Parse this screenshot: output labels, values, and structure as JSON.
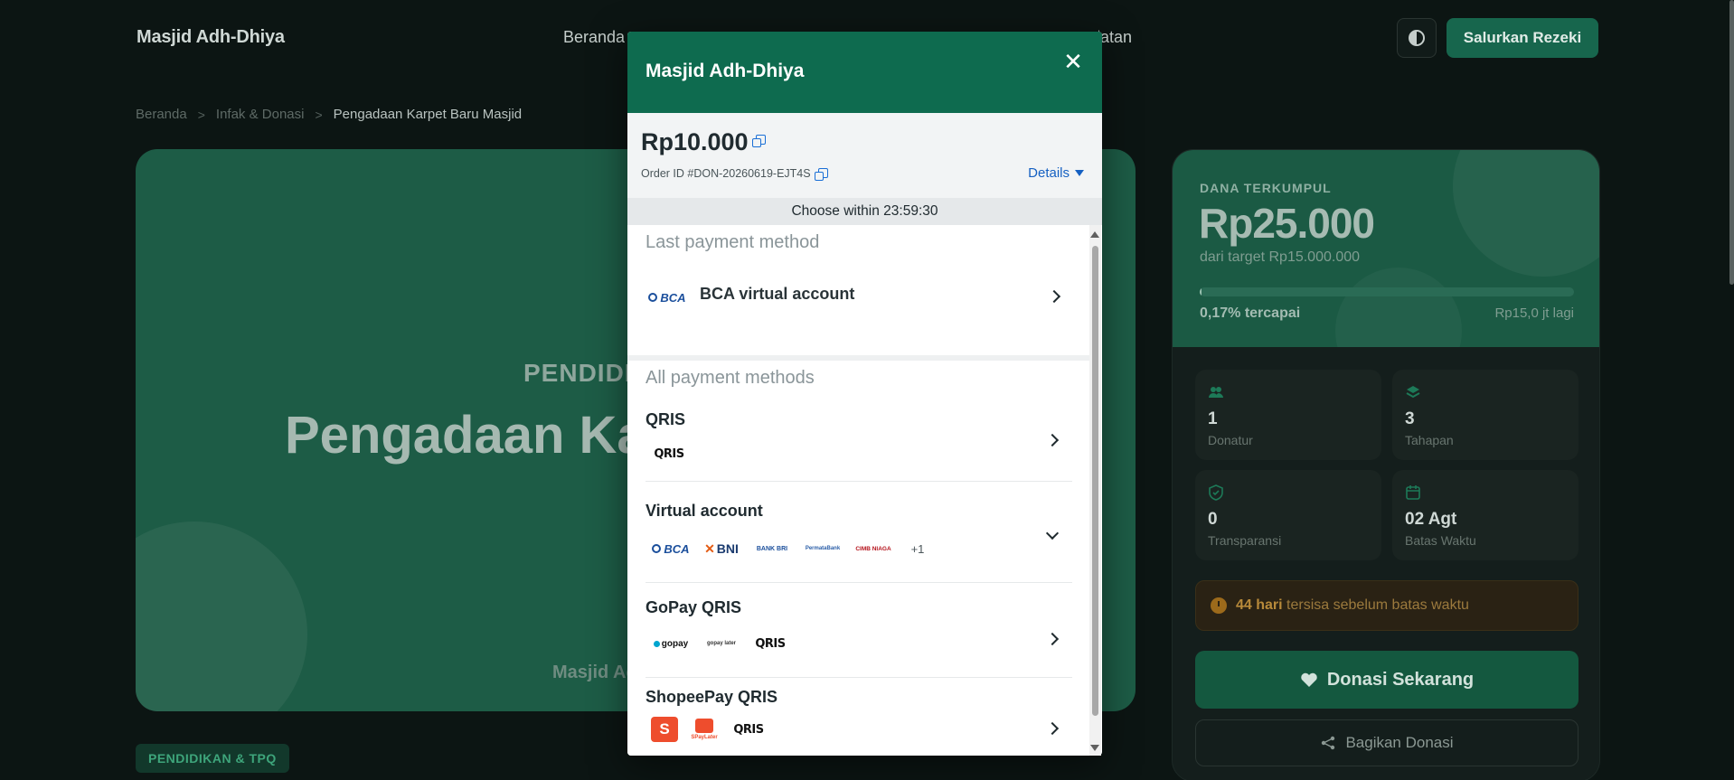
{
  "header": {
    "brand": "Masjid Adh-Dhiya",
    "nav": [
      "Beranda",
      "Kegiatan"
    ],
    "cta": "Salurkan Rezeki",
    "theme_icon": "half-circle-icon"
  },
  "breadcrumb": [
    "Beranda",
    "Infak & Donasi",
    "Pengadaan Karpet Baru Masjid"
  ],
  "hero": {
    "category": "PENDIDIKAN",
    "title": "Pengadaan Karpet Baru Masjid",
    "subtitle": "Masjid Adh-Dhiya",
    "badge": "PENDIDIKAN & TPQ"
  },
  "fund": {
    "label": "DANA TERKUMPUL",
    "value": "Rp25.000",
    "target": "dari target Rp15.000.000",
    "progress_percent": 0.17,
    "progress_text": "0,17% tercapai",
    "remaining": "Rp15,0 jt lagi",
    "stats": [
      {
        "icon": "users-icon",
        "value": "1",
        "label": "Donatur"
      },
      {
        "icon": "layers-icon",
        "value": "3",
        "label": "Tahapan"
      },
      {
        "icon": "shield-check-icon",
        "value": "0",
        "label": "Transparansi"
      },
      {
        "icon": "calendar-icon",
        "value": "02 Agt",
        "label": "Batas Waktu"
      }
    ],
    "deadline_days": "44 hari",
    "deadline_text": "tersisa sebelum batas waktu",
    "donate_label": "Donasi Sekarang",
    "share_label": "Bagikan Donasi"
  },
  "modal": {
    "title": "Masjid Adh-Dhiya",
    "close_icon": "close-icon",
    "amount": "Rp10.000",
    "order_id": "Order ID #DON-20260619-EJT4S",
    "details": "Details",
    "timer": "Choose within 23:59:30",
    "last_method_header": "Last payment method",
    "last_method": {
      "logo": "BCA",
      "name": "BCA virtual account"
    },
    "all_methods_header": "All payment methods",
    "methods": [
      {
        "name": "QRIS",
        "logos": [
          "QRIS"
        ]
      },
      {
        "name": "Virtual account",
        "logos": [
          "BCA",
          "BNI",
          "BANK BRI",
          "PermataBank",
          "CIMB NIAGA"
        ],
        "more": "+1"
      },
      {
        "name": "GoPay QRIS",
        "logos": [
          "gopay",
          "gopay later",
          "QRIS"
        ]
      },
      {
        "name": "ShopeePay QRIS",
        "logos": [
          "S",
          "SPayLater",
          "QRIS"
        ]
      }
    ]
  }
}
